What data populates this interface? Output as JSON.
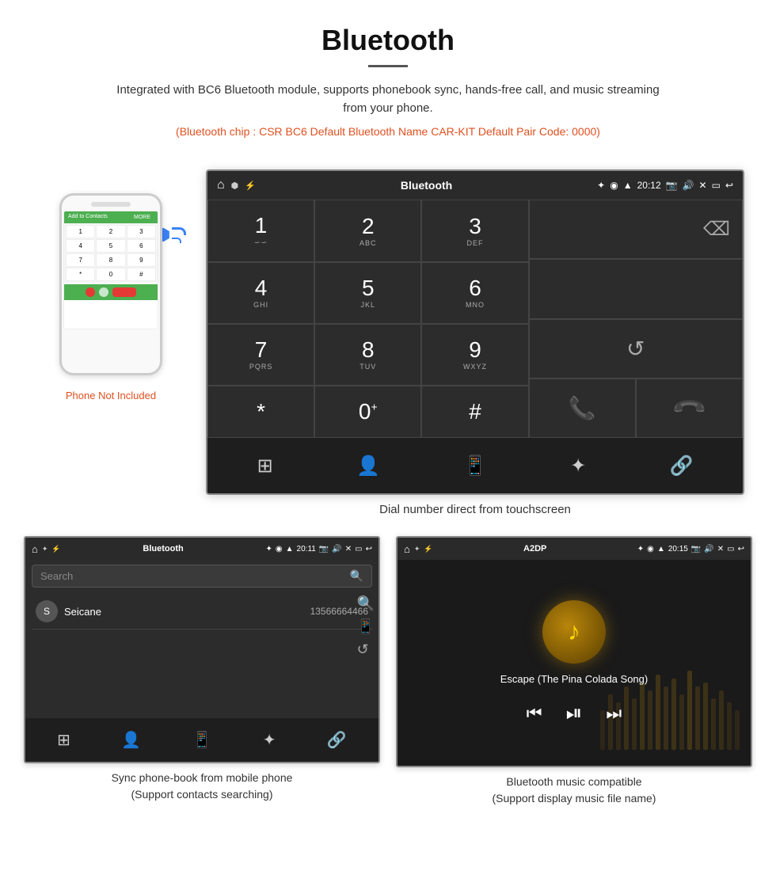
{
  "page": {
    "title": "Bluetooth",
    "divider": true,
    "description": "Integrated with BC6 Bluetooth module, supports phonebook sync, hands-free call, and music streaming from your phone.",
    "specs": "(Bluetooth chip : CSR BC6    Default Bluetooth Name CAR-KIT    Default Pair Code: 0000)"
  },
  "dialpad": {
    "status_bar": {
      "center": "Bluetooth",
      "time": "20:12"
    },
    "keys": [
      {
        "num": "1",
        "sub": "∽∽"
      },
      {
        "num": "2",
        "sub": "ABC"
      },
      {
        "num": "3",
        "sub": "DEF"
      },
      {
        "num": "4",
        "sub": "GHI"
      },
      {
        "num": "5",
        "sub": "JKL"
      },
      {
        "num": "6",
        "sub": "MNO"
      },
      {
        "num": "7",
        "sub": "PQRS"
      },
      {
        "num": "8",
        "sub": "TUV"
      },
      {
        "num": "9",
        "sub": "WXYZ"
      },
      {
        "num": "*",
        "sub": ""
      },
      {
        "num": "0+",
        "sub": ""
      },
      {
        "num": "#",
        "sub": ""
      }
    ],
    "caption": "Dial number direct from touchscreen"
  },
  "phone": {
    "not_included_label": "Phone Not Included",
    "screen_title": "Add to Contacts",
    "keys": [
      "1",
      "2",
      "3",
      "4",
      "5",
      "6",
      "7",
      "8",
      "9",
      "*",
      "0",
      "#"
    ],
    "call_label": "MORE"
  },
  "phonebook_screen": {
    "status_center": "Bluetooth",
    "time": "20:11",
    "search_placeholder": "Search",
    "contact_initial": "S",
    "contact_name": "Seicane",
    "contact_number": "13566664466",
    "caption_line1": "Sync phone-book from mobile phone",
    "caption_line2": "(Support contacts searching)"
  },
  "music_screen": {
    "status_center": "A2DP",
    "time": "20:15",
    "song_title": "Escape (The Pina Colada Song)",
    "caption_line1": "Bluetooth music compatible",
    "caption_line2": "(Support display music file name)"
  },
  "icons": {
    "home": "⌂",
    "bluetooth": "✦",
    "usb": "⚡",
    "bt_symbol": "B",
    "gps": "◉",
    "wifi_signal": "▲",
    "camera": "📷",
    "volume": "🔊",
    "close_x": "✕",
    "window": "▭",
    "back": "↩",
    "backspace": "⌫",
    "phone_green": "📞",
    "phone_red": "📞",
    "refresh": "↺",
    "grid": "⊞",
    "person": "👤",
    "phone_outline": "📱",
    "bt_icon": "⚡",
    "link": "🔗",
    "search": "🔍",
    "prev": "⏮",
    "play_pause": "⏯",
    "next": "⏭",
    "music_note": "♪"
  }
}
